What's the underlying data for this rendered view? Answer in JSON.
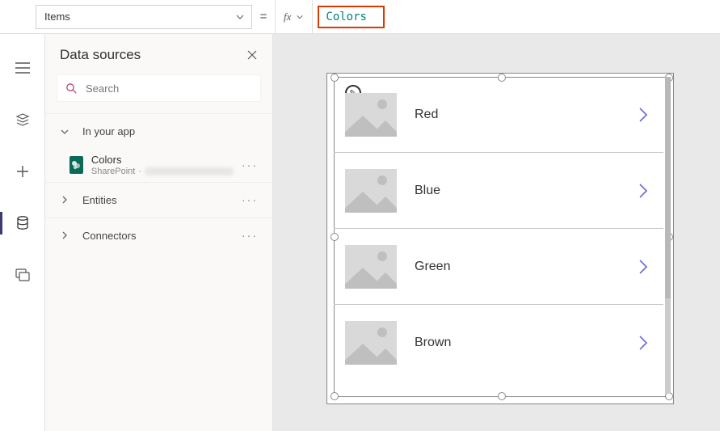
{
  "topbar": {
    "property_label": "Items",
    "equals": "=",
    "fx_label": "fx",
    "formula": "Colors"
  },
  "rail": {
    "items": [
      "menu",
      "layers",
      "insert",
      "data",
      "media"
    ]
  },
  "panel": {
    "title": "Data sources",
    "search_placeholder": "Search",
    "sections": {
      "in_app": {
        "label": "In your app"
      },
      "entities": {
        "label": "Entities"
      },
      "connectors": {
        "label": "Connectors"
      }
    },
    "datasource": {
      "name": "Colors",
      "provider": "SharePoint",
      "dot": "·"
    }
  },
  "gallery": {
    "items": [
      {
        "title": "Red"
      },
      {
        "title": "Blue"
      },
      {
        "title": "Green"
      },
      {
        "title": "Brown"
      }
    ],
    "edit_glyph": "✎"
  }
}
